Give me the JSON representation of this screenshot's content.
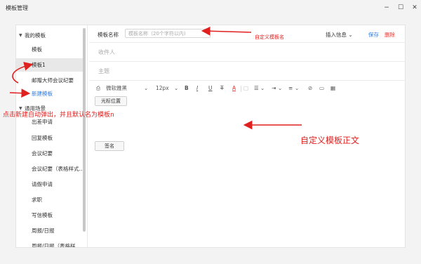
{
  "window": {
    "title": "模板管理",
    "controls": {
      "minimize": "−",
      "maximize": "☐",
      "close": "✕"
    }
  },
  "sidebar": {
    "groups": [
      {
        "label": "我的模板",
        "expanded": true,
        "items": [
          "模板",
          "模板1",
          "邮赠大师会议纪要",
          "新建模板"
        ]
      },
      {
        "label": "通用场景",
        "expanded": true,
        "items": [
          "出差申请",
          "回复模板",
          "会议纪要",
          "会议纪要（表格样式…",
          "请假申请",
          "求职",
          "写信模板",
          "周报/日报",
          "周报/日报（表格样…"
        ]
      }
    ],
    "active_item": "模板1"
  },
  "editor": {
    "name_label": "模板名称",
    "name_value": "",
    "name_placeholder": "模板名称（20个字符以内)",
    "insert_info": "插入信息",
    "save": "保存",
    "delete": "删除",
    "recipient_label": "收件人",
    "subject_label": "主题",
    "toolbar": {
      "paint": "⎙",
      "font": "微软雅黑",
      "font_size": "12px",
      "bold": "B",
      "italic": "I",
      "underline": "U",
      "strike": "T",
      "color": "A",
      "list": "☰",
      "indent": "⇥",
      "align": "≡",
      "link": "⊘",
      "image": "▭",
      "table": "▦",
      "dropdown": "⌄"
    },
    "cursor_button": "光标位置",
    "sign_button": "签名"
  },
  "annotations": {
    "name": "自定义模板名",
    "body": "自定义模板正文",
    "auto": "点击新建自动弹出，并且默认名为模板n",
    "color": "#e0201e"
  }
}
